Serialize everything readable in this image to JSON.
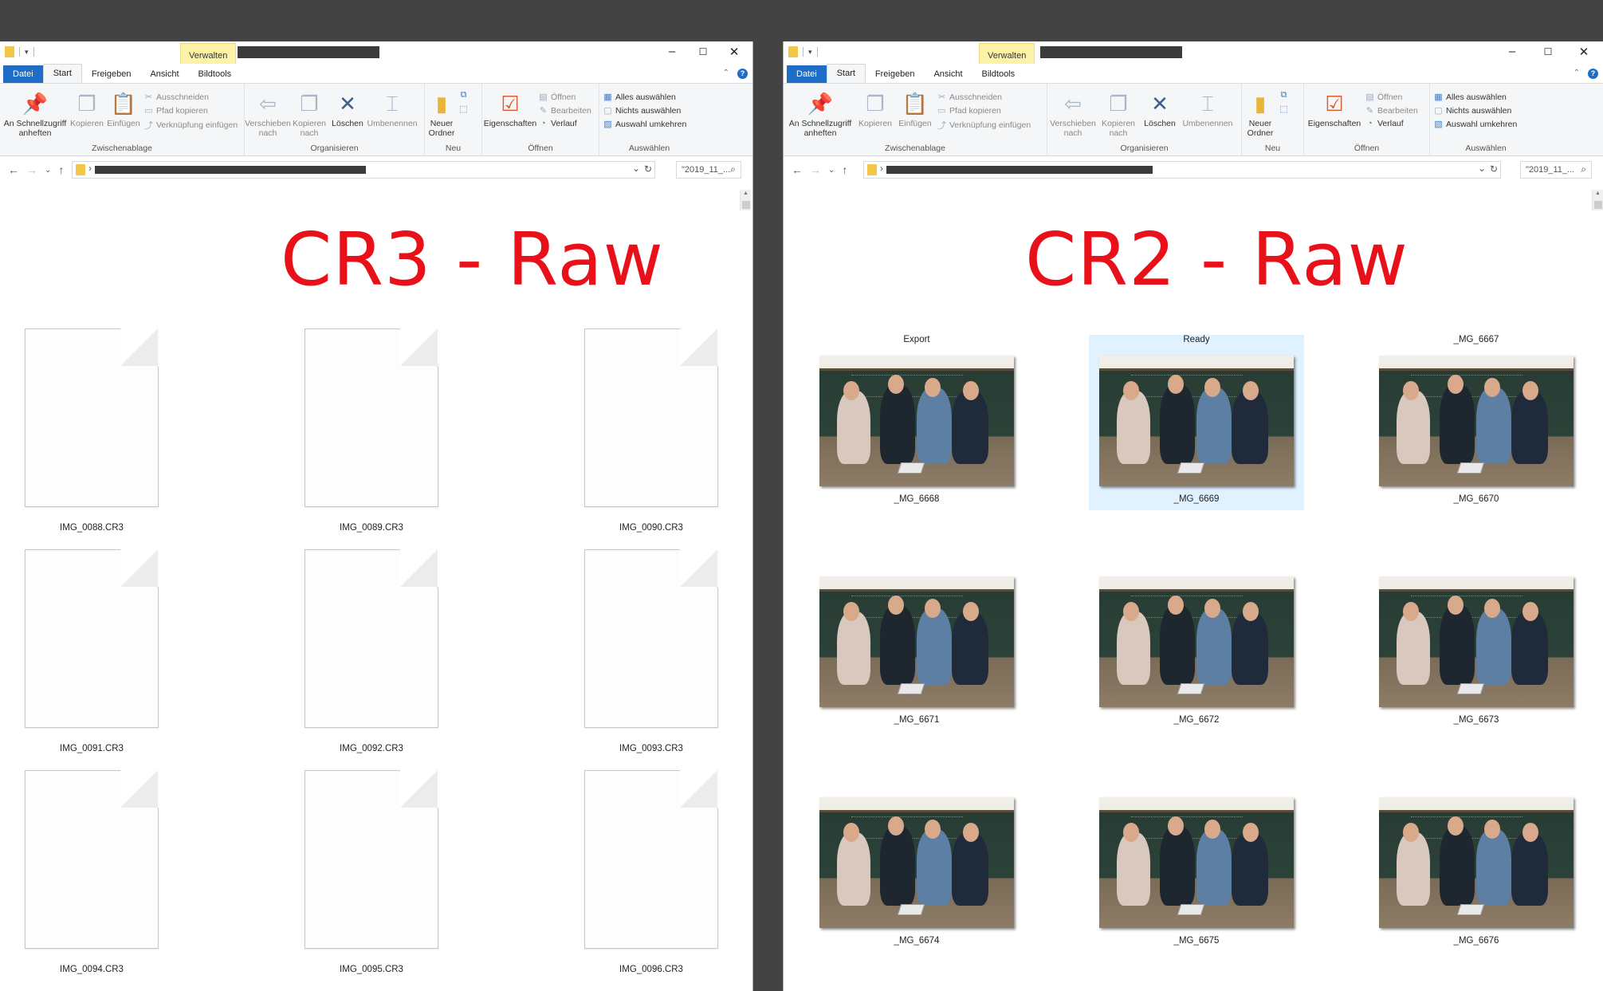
{
  "left": {
    "ctx_tab": "Verwalten",
    "tabs": [
      "Datei",
      "Start",
      "Freigeben",
      "Ansicht",
      "Bildtools"
    ],
    "ribbon": {
      "pin": "An Schnellzugriff anheften",
      "copy": "Kopieren",
      "paste": "Einfügen",
      "cut": "Ausschneiden",
      "copy_path": "Pfad kopieren",
      "paste_shortcut": "Verknüpfung einfügen",
      "clipboard": "Zwischenablage",
      "move_to": "Verschieben nach",
      "copy_to": "Kopieren nach",
      "delete": "Löschen",
      "rename": "Umbenennen",
      "organize": "Organisieren",
      "new_folder": "Neuer Ordner",
      "new": "Neu",
      "properties": "Eigenschaften",
      "open": "Öffnen",
      "edit": "Bearbeiten",
      "history": "Verlauf",
      "open_group": "Öffnen",
      "select_all": "Alles auswählen",
      "select_none": "Nichts auswählen",
      "invert_selection": "Auswahl umkehren",
      "select_group": "Auswählen"
    },
    "search_text": "\"2019_11_...",
    "heading": "CR3 - Raw",
    "files": [
      "IMG_0088.CR3",
      "IMG_0089.CR3",
      "IMG_0090.CR3",
      "IMG_0091.CR3",
      "IMG_0092.CR3",
      "IMG_0093.CR3",
      "IMG_0094.CR3",
      "IMG_0095.CR3",
      "IMG_0096.CR3"
    ]
  },
  "right": {
    "ctx_tab": "Verwalten",
    "tabs": [
      "Datei",
      "Start",
      "Freigeben",
      "Ansicht",
      "Bildtools"
    ],
    "ribbon": {
      "pin": "An Schnellzugriff anheften",
      "copy": "Kopieren",
      "paste": "Einfügen",
      "cut": "Ausschneiden",
      "copy_path": "Pfad kopieren",
      "paste_shortcut": "Verknüpfung einfügen",
      "clipboard": "Zwischenablage",
      "move_to": "Verschieben nach",
      "copy_to": "Kopieren nach",
      "delete": "Löschen",
      "rename": "Umbenennen",
      "organize": "Organisieren",
      "new_folder": "Neuer Ordner",
      "new": "Neu",
      "properties": "Eigenschaften",
      "open": "Öffnen",
      "edit": "Bearbeiten",
      "history": "Verlauf",
      "open_group": "Öffnen",
      "select_all": "Alles auswählen",
      "select_none": "Nichts auswählen",
      "invert_selection": "Auswahl umkehren",
      "select_group": "Auswählen"
    },
    "search_text": "\"2019_11_...",
    "heading": "CR2 - Raw",
    "top_labels": [
      "Export",
      "Ready",
      "_MG_6667"
    ],
    "photos": [
      "_MG_6668",
      "_MG_6669",
      "_MG_6670",
      "_MG_6671",
      "_MG_6672",
      "_MG_6673",
      "_MG_6674",
      "_MG_6675",
      "_MG_6676"
    ],
    "selected_photo": "_MG_6669"
  },
  "colors": {
    "heading_red": "#e8111a",
    "file_tab_blue": "#1e6ec8",
    "context_tab_yellow": "#fcf2a8",
    "selection_blue": "#cce8ff",
    "desktop_gap": "#434343"
  }
}
